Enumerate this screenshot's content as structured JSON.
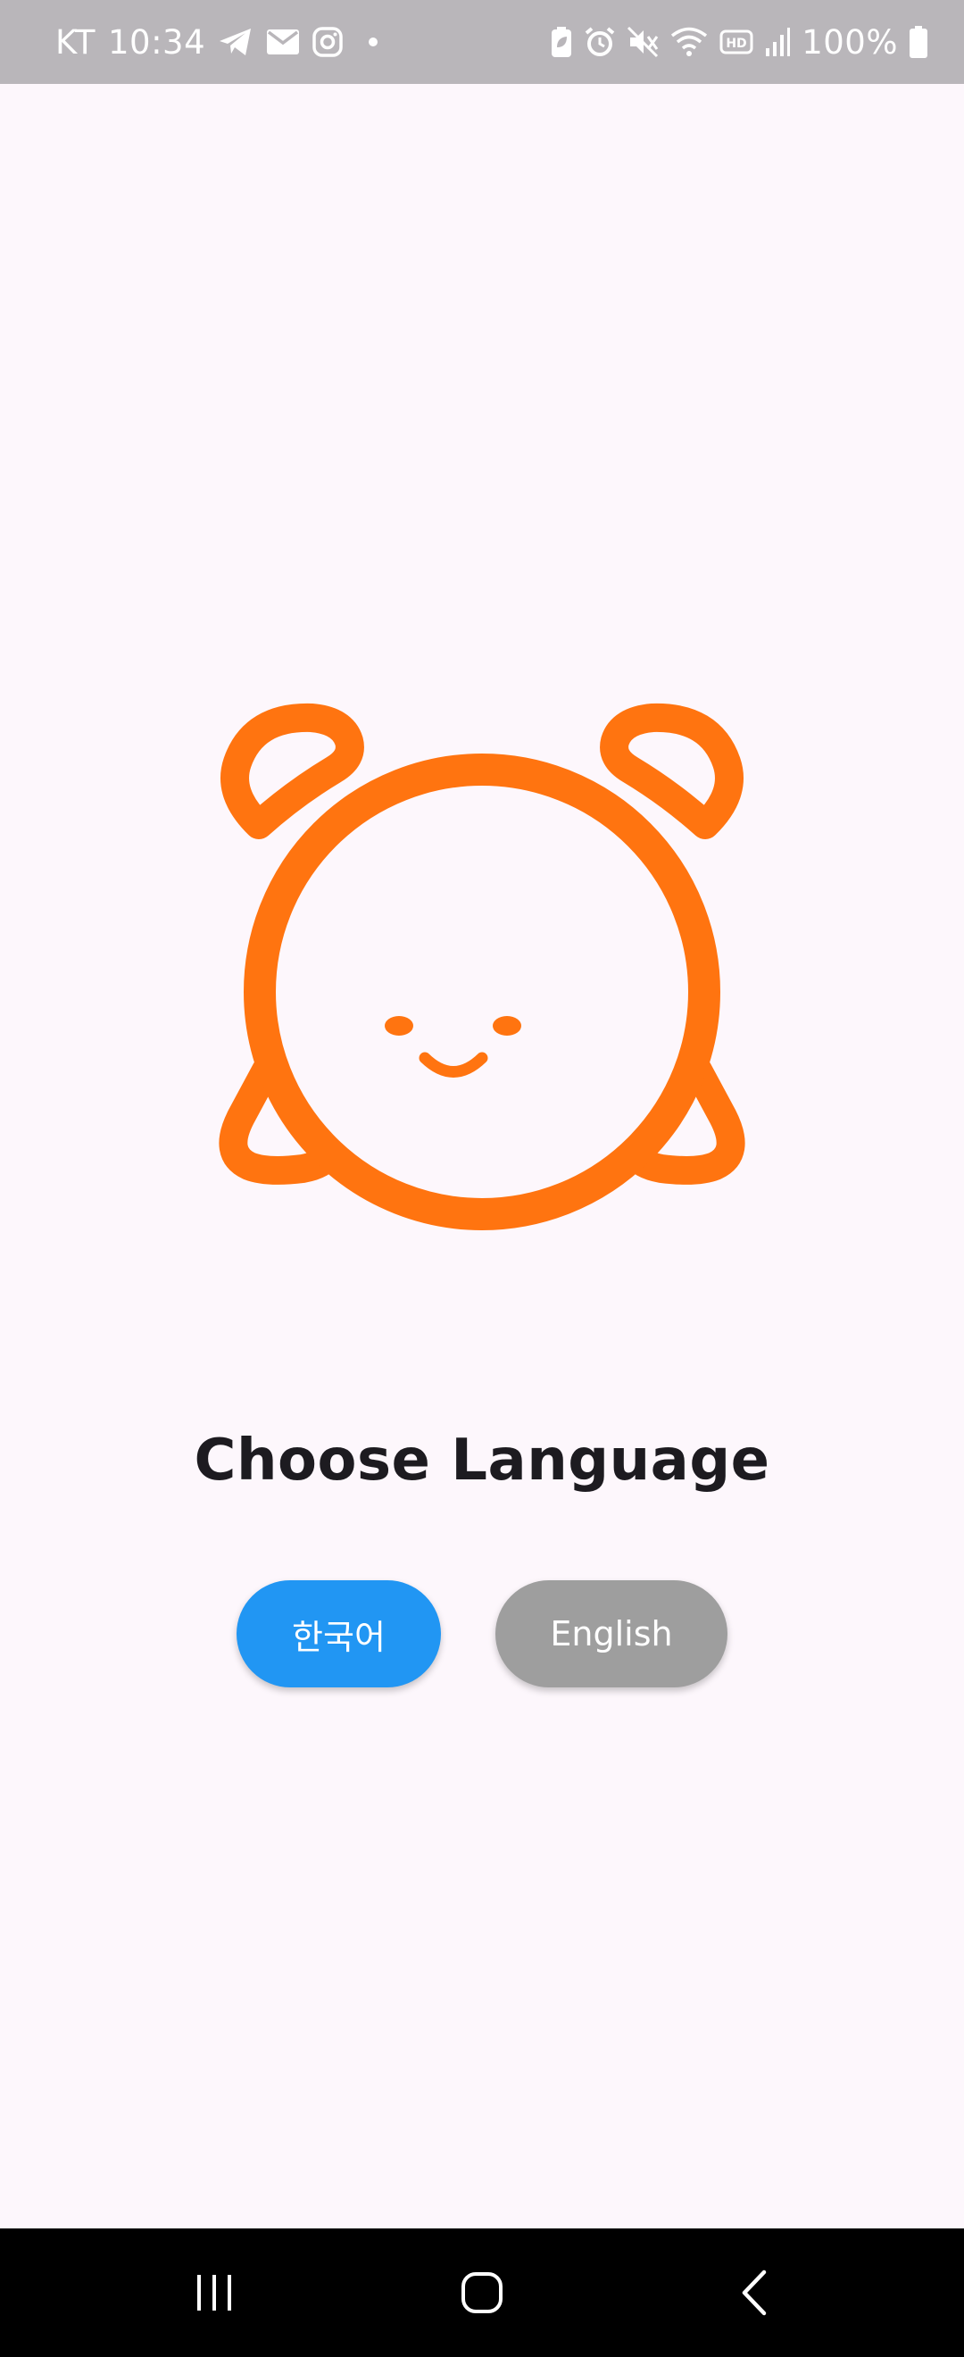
{
  "status_bar": {
    "carrier": "KT",
    "time": "10:34",
    "battery_percent": "100%",
    "left_icons": [
      "telegram-icon",
      "mail-icon",
      "instagram-icon",
      "notification-dot-icon"
    ],
    "right_icons": [
      "battery-saver-icon",
      "alarm-icon",
      "mute-icon",
      "wifi-icon",
      "hd-voice-icon",
      "signal-icon",
      "battery-icon"
    ],
    "background_color": "#b9b6ba"
  },
  "main": {
    "logo": {
      "icon": "alarm-clock-face-icon",
      "color": "#ff7410"
    },
    "heading": "Choose Language",
    "buttons": {
      "korean_label": "한국어",
      "english_label": "English",
      "korean_color": "#2196f3",
      "english_color": "#9e9e9e"
    }
  },
  "nav_bar": {
    "buttons": [
      "recents-icon",
      "home-icon",
      "back-icon"
    ]
  }
}
